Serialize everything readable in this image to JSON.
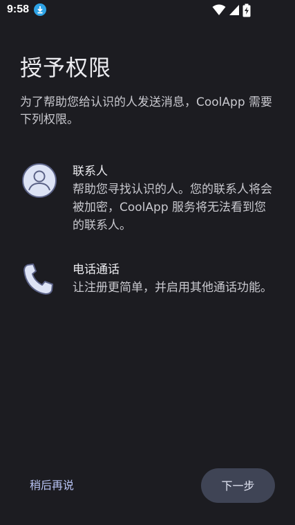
{
  "status_bar": {
    "time": "9:58",
    "icons": [
      "download-icon",
      "wifi-icon",
      "signal-icon",
      "battery-charging-icon"
    ]
  },
  "page": {
    "title": "授予权限",
    "subtitle": "为了帮助您给认识的人发送消息，CoolApp 需要下列权限。"
  },
  "permissions": [
    {
      "icon": "contact-person-icon",
      "title": "联系人",
      "description": "帮助您寻找认识的人。您的联系人将会被加密，CoolApp 服务将无法看到您的联系人。"
    },
    {
      "icon": "phone-icon",
      "title": "电话通话",
      "description": "让注册更简单，并启用其他通话功能。"
    }
  ],
  "actions": {
    "skip_label": "稍后再说",
    "next_label": "下一步"
  },
  "colors": {
    "background": "#1c1c21",
    "accent_text": "#b9c4f5",
    "primary_button": "#3f4455",
    "icon_fill": "#dde3f5",
    "icon_stroke": "#5b6287"
  }
}
